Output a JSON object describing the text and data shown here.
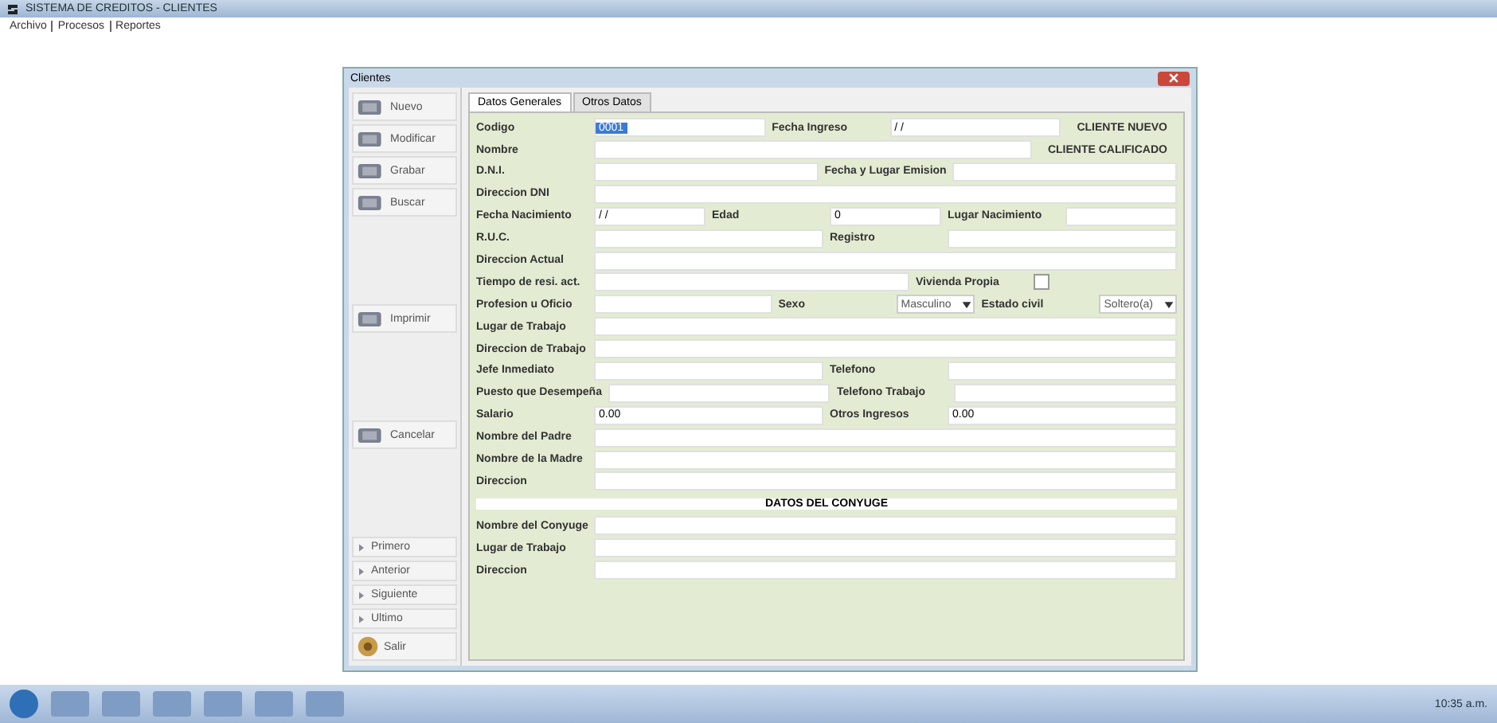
{
  "app": {
    "title": "SISTEMA DE CREDITOS - CLIENTES",
    "menu": [
      "Archivo",
      "Procesos",
      "Reportes"
    ]
  },
  "window": {
    "title": "Clientes"
  },
  "sidebar": [
    {
      "kind": "big",
      "label": "Nuevo"
    },
    {
      "kind": "big",
      "label": "Modificar"
    },
    {
      "kind": "big",
      "label": "Grabar"
    },
    {
      "kind": "big",
      "label": "Buscar"
    },
    {
      "kind": "gap"
    },
    {
      "kind": "big",
      "label": "Imprimir"
    },
    {
      "kind": "gap"
    },
    {
      "kind": "big",
      "label": "Cancelar"
    },
    {
      "kind": "gap"
    },
    {
      "kind": "small",
      "label": "Primero"
    },
    {
      "kind": "small",
      "label": "Anterior"
    },
    {
      "kind": "small",
      "label": "Siguiente"
    },
    {
      "kind": "small",
      "label": "Ultimo"
    },
    {
      "kind": "exit",
      "label": "Salir"
    }
  ],
  "tabs": [
    {
      "label": "Datos Generales",
      "selected": true
    },
    {
      "label": "Otros Datos",
      "selected": false
    }
  ],
  "rows": [
    [
      {
        "kind": "label",
        "text": "Codigo"
      },
      {
        "kind": "field",
        "value": "0001",
        "selected": true
      },
      {
        "kind": "label",
        "text": "Fecha Ingreso"
      },
      {
        "kind": "field",
        "value": "/ /"
      },
      {
        "kind": "note",
        "text": "CLIENTE NUEVO"
      }
    ],
    [
      {
        "kind": "label",
        "text": "Nombre"
      },
      {
        "kind": "field"
      },
      {
        "kind": "note",
        "text": "CLIENTE CALIFICADO"
      }
    ],
    [
      {
        "kind": "label",
        "text": "D.N.I."
      },
      {
        "kind": "field"
      },
      {
        "kind": "label",
        "text": "Fecha y Lugar Emision"
      },
      {
        "kind": "field"
      }
    ],
    [
      {
        "kind": "label",
        "text": "Direccion DNI"
      },
      {
        "kind": "field"
      }
    ],
    [
      {
        "kind": "label",
        "text": "Fecha Nacimiento"
      },
      {
        "kind": "field",
        "value": "/ /"
      },
      {
        "kind": "label",
        "text": "Edad"
      },
      {
        "kind": "field",
        "value": "0"
      },
      {
        "kind": "label",
        "text": "Lugar Nacimiento"
      },
      {
        "kind": "field"
      }
    ],
    [
      {
        "kind": "label",
        "text": "R.U.C."
      },
      {
        "kind": "field"
      },
      {
        "kind": "label",
        "text": "Registro"
      },
      {
        "kind": "field"
      }
    ],
    [
      {
        "kind": "label",
        "text": "Direccion Actual"
      },
      {
        "kind": "field"
      }
    ],
    [
      {
        "kind": "label",
        "text": "Tiempo de resi. act."
      },
      {
        "kind": "field"
      },
      {
        "kind": "label",
        "text": "Vivienda Propia"
      },
      {
        "kind": "check",
        "checked": false
      }
    ],
    [
      {
        "kind": "label",
        "text": "Profesion u Oficio"
      },
      {
        "kind": "field"
      },
      {
        "kind": "label",
        "text": "Sexo"
      },
      {
        "kind": "combo",
        "value": "Masculino"
      },
      {
        "kind": "label",
        "text": "Estado civil"
      },
      {
        "kind": "combo",
        "value": "Soltero(a)"
      }
    ],
    [
      {
        "kind": "label",
        "text": "Lugar de Trabajo"
      },
      {
        "kind": "field"
      }
    ],
    [
      {
        "kind": "label",
        "text": "Direccion de Trabajo"
      },
      {
        "kind": "field"
      }
    ],
    [
      {
        "kind": "label",
        "text": "Jefe Inmediato"
      },
      {
        "kind": "field"
      },
      {
        "kind": "label",
        "text": "Telefono"
      },
      {
        "kind": "field"
      }
    ],
    [
      {
        "kind": "label",
        "text": "Puesto que Desempeña"
      },
      {
        "kind": "field"
      },
      {
        "kind": "label",
        "text": "Telefono Trabajo"
      },
      {
        "kind": "field"
      }
    ],
    [
      {
        "kind": "label",
        "text": "Salario"
      },
      {
        "kind": "field",
        "value": "0.00"
      },
      {
        "kind": "label",
        "text": "Otros Ingresos"
      },
      {
        "kind": "field",
        "value": "0.00"
      }
    ],
    [
      {
        "kind": "label",
        "text": "Nombre del Padre"
      },
      {
        "kind": "field"
      }
    ],
    [
      {
        "kind": "label",
        "text": "Nombre de la Madre"
      },
      {
        "kind": "field"
      }
    ],
    [
      {
        "kind": "label",
        "text": "Direccion"
      },
      {
        "kind": "field"
      }
    ],
    [
      {
        "kind": "section",
        "text": "DATOS DEL CONYUGE"
      }
    ],
    [
      {
        "kind": "label",
        "text": "Nombre del Conyuge"
      },
      {
        "kind": "field"
      }
    ],
    [
      {
        "kind": "label",
        "text": "Lugar de Trabajo"
      },
      {
        "kind": "field"
      }
    ],
    [
      {
        "kind": "label",
        "text": "Direccion"
      },
      {
        "kind": "field"
      }
    ]
  ],
  "taskbar": {
    "clock": "10:35 a.m."
  }
}
